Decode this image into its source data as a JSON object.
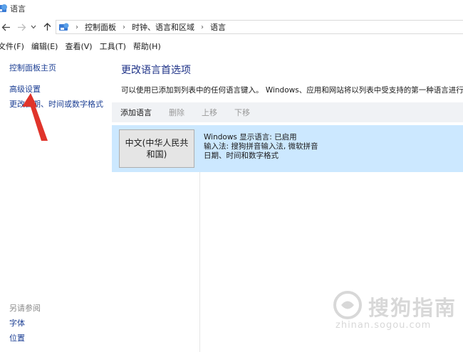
{
  "window": {
    "title": "语言"
  },
  "nav": {
    "back_icon": "back-arrow-icon",
    "forward_icon": "forward-arrow-icon",
    "recent_icon": "chevron-down-icon",
    "up_icon": "up-arrow-icon"
  },
  "breadcrumb": [
    "控制面板",
    "时钟、语言和区域",
    "语言"
  ],
  "menu": [
    "文件(F)",
    "编辑(E)",
    "查看(V)",
    "工具(T)",
    "帮助(H)"
  ],
  "sidebar": {
    "links": [
      "控制面板主页",
      "高级设置",
      "更改日期、时间或数字格式"
    ],
    "see_also_heading": "另请参阅",
    "see_also": [
      "字体",
      "位置"
    ]
  },
  "main": {
    "title": "更改语言首选项",
    "description": "可以使用已添加到列表中的任何语言键入。 Windows、应用和网站将以列表中受支持的第一种语言进行显示",
    "toolbar": {
      "add": "添加语言",
      "remove": "删除",
      "up": "上移",
      "down": "下移"
    },
    "language": {
      "name_line1": "中文(中华人民共",
      "name_line2": "和国)",
      "info": [
        "Windows 显示语言: 已启用",
        "输入法: 搜狗拼音输入法, 微软拼音",
        "日期、时间和数字格式"
      ]
    }
  },
  "watermark": {
    "name": "搜狗指南",
    "url": "zhinan.sogou.com"
  },
  "colors": {
    "title": "#1e3287",
    "link": "#1c3f94",
    "selection": "#cce8ff",
    "annotation_arrow": "#e0342b"
  }
}
